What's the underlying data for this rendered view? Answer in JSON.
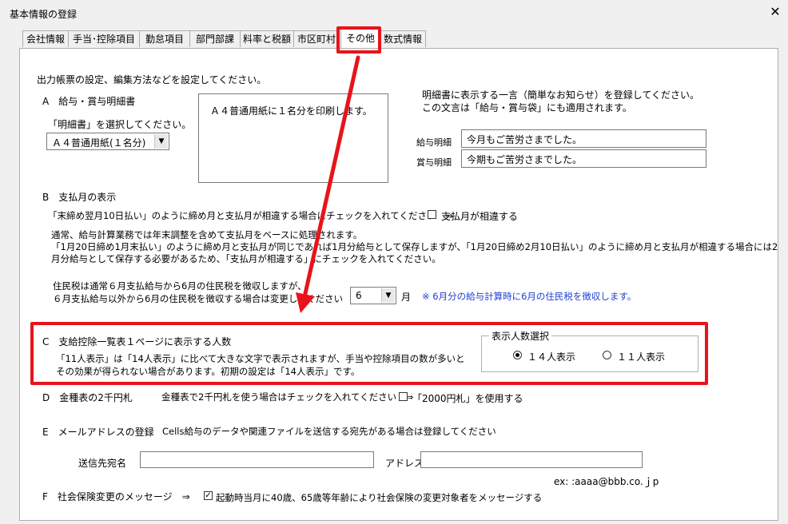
{
  "window": {
    "title": "基本情報の登録",
    "close_glyph": "✕"
  },
  "tabs": [
    "会社情報",
    "手当･控除項目",
    "勤怠項目",
    "部門部課",
    "料率と税額",
    "市区町村",
    "その他",
    "数式情報"
  ],
  "intro": "出力帳票の設定、編集方法などを設定してください。",
  "sectionA": {
    "title": "A　給与・賞与明細書",
    "select_label": "「明細書」を選択してください。",
    "select_value": "Ａ４普通用紙(１名分)",
    "preview_text": "Ａ４普通用紙に１名分を印刷します。",
    "message_desc1": "明細書に表示する一言（簡単なお知らせ）を登録してください。",
    "message_desc2": "この文言は「給与・賞与袋」にも適用されます。",
    "salary_label": "給与明細",
    "salary_value": "今月もご苦労さまでした。",
    "bonus_label": "賞与明細",
    "bonus_value": "今期もご苦労さまでした。"
  },
  "sectionB": {
    "title": "B　支払月の表示",
    "check_desc": "「末締め翌月10日払い」のように締め月と支払月が相違する場合にチェックを入れてください　⇒",
    "check_label": "支払月が相違する",
    "note1": "通常、給与計算業務では年末調整を含めて支払月をベースに処理されます。",
    "note2": "「1月20日締め1月末払い」のように締め月と支払月が同じであれば1月分給与として保存しますが、「1月20日締め2月10日払い」のように締め月と支払月が相違する場合には2",
    "note3": "月分給与として保存する必要があるため、「支払月が相違する」にチェックを入れてください。",
    "resident1": "住民税は通常６月支払給与から6月の住民税を徴収しますが、",
    "resident2": "６月支払給与以外から6月の住民税を徴収する場合は変更してください　⇒",
    "month_value": "6",
    "month_unit": "月",
    "month_note": "※ 6月分の給与計算時に6月の住民税を徴収します。"
  },
  "sectionC": {
    "title": "C　支給控除一覧表１ページに表示する人数",
    "desc1": "「11人表示」は「14人表示」に比べて大きな文字で表示されますが、手当や控除項目の数が多いと",
    "desc2": "その効果が得られない場合があります。初期の設定は「14人表示」です。",
    "group_label": "表示人数選択",
    "option14": "１４人表示",
    "option11": "１１人表示"
  },
  "sectionD": {
    "title": "D　金種表の2千円札",
    "desc": "金種表で2千円札を使う場合はチェックを入れてください　⇒",
    "check_label": "「2000円札」を使用する"
  },
  "sectionE": {
    "title": "E　メールアドレスの登録",
    "desc": "Cells給与のデータや関連ファイルを送信する宛先がある場合は登録してください",
    "name_label": "送信先宛名",
    "address_label": "アドレス",
    "example": "ex: :aaaa@bbb.co.ｊp"
  },
  "sectionF": {
    "title": "F　社会保険変更のメッセージ　⇒",
    "check_label": "起動時当月に40歳、65歳等年齢により社会保険の変更対象者をメッセージする"
  },
  "colors": {
    "highlight": "#e8131b",
    "note_blue": "#1e3fd0"
  }
}
